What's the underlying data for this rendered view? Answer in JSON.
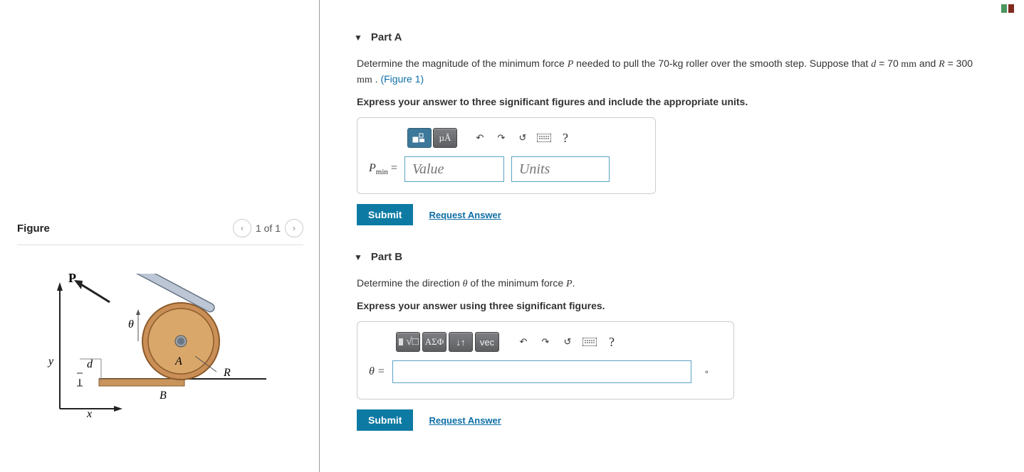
{
  "figure": {
    "title": "Figure",
    "pager_text": "1 of 1",
    "labels": {
      "P": "P",
      "theta": "θ",
      "y": "y",
      "x": "x",
      "d": "d",
      "A": "A",
      "B": "B",
      "R": "R"
    }
  },
  "partA": {
    "title": "Part A",
    "prompt_pre": "Determine the magnitude of the minimum force ",
    "prompt_mid1": " needed to pull the 70-kg roller over the smooth step. Suppose that ",
    "d_eq": " = 70",
    "d_unit": "  mm",
    "and": " and ",
    "R_eq": " = 300",
    "R_unit": "  mm",
    "period": " . ",
    "figure_link": "(Figure 1)",
    "instruction": "Express your answer to three significant figures and include the appropriate units.",
    "toolbar": {
      "units_btn": "µÅ",
      "help": "?"
    },
    "var_label_html": "P_min =",
    "value_placeholder": "Value",
    "units_placeholder": "Units",
    "submit": "Submit",
    "request_answer": "Request Answer"
  },
  "partB": {
    "title": "Part B",
    "prompt_pre": "Determine the direction ",
    "theta": "θ",
    "prompt_mid": " of the minimum force ",
    "P": "P",
    "period": ".",
    "instruction": "Express your answer using three significant figures.",
    "toolbar": {
      "greek": "ΑΣΦ",
      "vec": "vec",
      "help": "?"
    },
    "var_label": "θ =",
    "deg_symbol": "∘",
    "submit": "Submit",
    "request_answer": "Request Answer"
  }
}
